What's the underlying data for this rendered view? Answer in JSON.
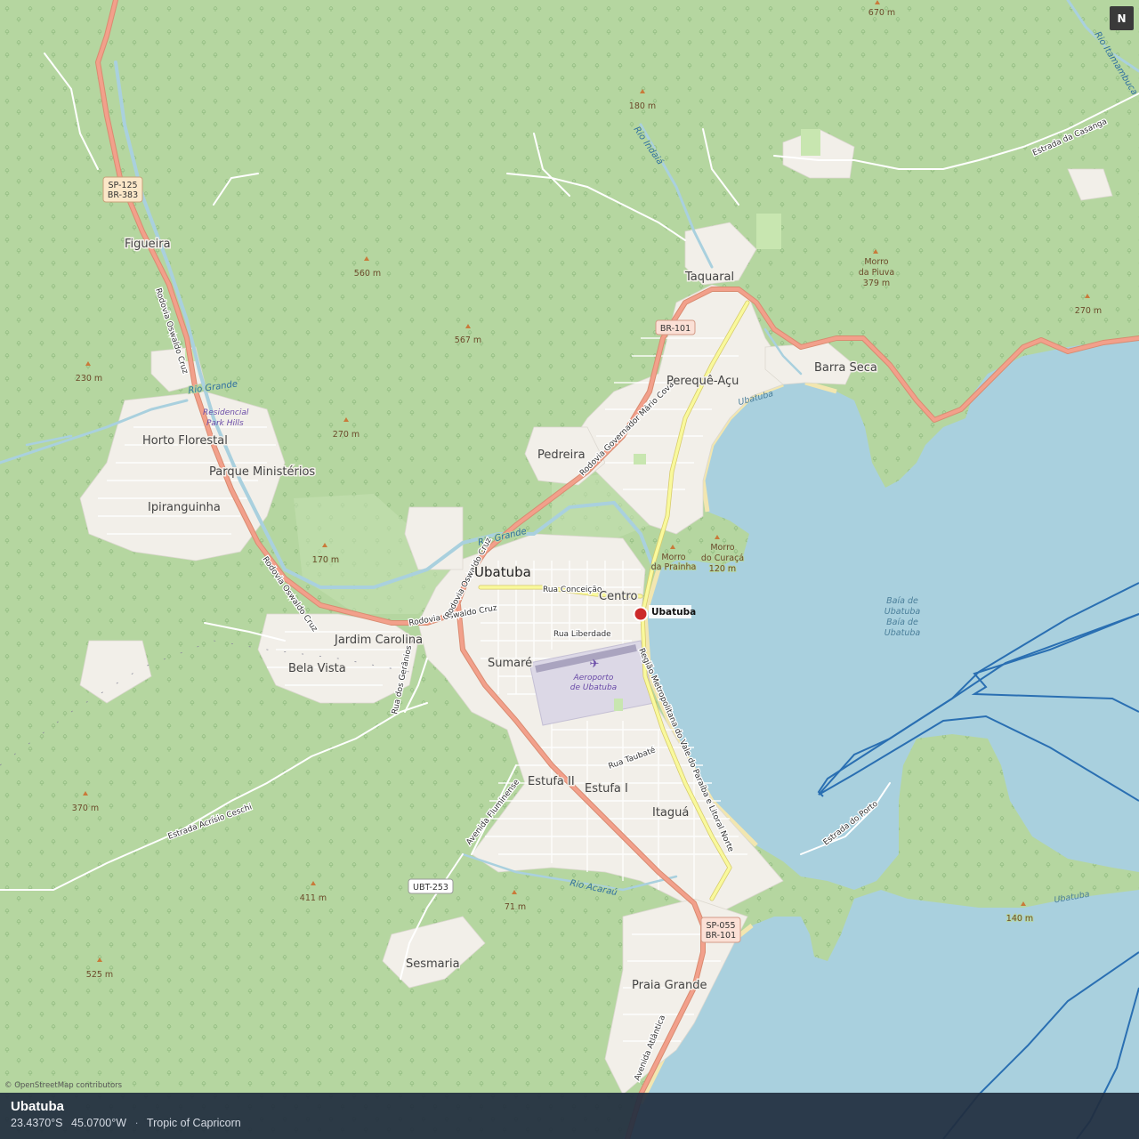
{
  "map": {
    "compass": "N",
    "attribution": "© OpenStreetMap contributors",
    "marker": {
      "label": "Ubatuba",
      "color": "#cc2a2a"
    },
    "colors": {
      "forest": "#b5d6a0",
      "water": "#a9d0de",
      "urban": "#f2efe9",
      "trunk_road": "#f2a08b",
      "secondary_road": "#f9f99c",
      "route": "#2a6fb2"
    },
    "places": {
      "figueira": "Figueira",
      "horto_florestal": "Horto Florestal",
      "parque_ministerios": "Parque Ministérios",
      "ipiranguinha": "Ipiranguinha",
      "residencial": "Residencial",
      "park_hills": "Park Hills",
      "taquaral": "Taquaral",
      "pereque": "Perequê-Açu",
      "barra_seca": "Barra Seca",
      "pedreira": "Pedreira",
      "ubatuba": "Ubatuba",
      "centro": "Centro",
      "jardim_carolina": "Jardim Carolina",
      "bela_vista": "Bela Vista",
      "sumare": "Sumaré",
      "estufa_ii": "Estufa II",
      "estufa_i": "Estufa I",
      "itagua": "Itaguá",
      "sesmaria": "Sesmaria",
      "praia_grande": "Praia Grande"
    },
    "peaks": {
      "p670": "670 m",
      "p180": "180 m",
      "p560": "560 m",
      "p567": "567 m",
      "p230": "230 m",
      "p270a": "270 m",
      "p170": "170 m",
      "piuva_1": "Morro",
      "piuva_2": "da Piuva",
      "piuva_3": "379 m",
      "p270b": "270 m",
      "prainha_1": "Morro",
      "prainha_2": "da Prainha",
      "curaca_1": "Morro",
      "curaca_2": "do Curaçá",
      "curaca_3": "120 m",
      "p370": "370 m",
      "p411": "411 m",
      "p71": "71 m",
      "p525": "525 m",
      "p140": "140 m"
    },
    "rivers": {
      "rio_grande_a": "Rio Grande",
      "rio_grande_b": "Rio Grande",
      "rio_indaia": "Rio Indaiá",
      "rio_acarau": "Rio Acaraú",
      "rio_itamambuca": "Rio Itamambuca"
    },
    "water": {
      "baia_1": "Baía de",
      "baia_2": "Ubatuba",
      "baia_3": "Baía de",
      "baia_4": "Ubatuba",
      "coast_a": "Ubatuba",
      "coast_b": "Ubatuba"
    },
    "streets": {
      "oswaldo_cruz_n": "Rodovia Oswaldo Cruz",
      "oswaldo_cruz_s1": "Rodovia Oswaldo Cruz",
      "oswaldo_cruz_s2": "Rodovia Oswaldo Cruz",
      "oswaldo_cruz_e": "Rodovia Oswaldo Cruz",
      "mario_covas": "Rodovia Governador Mário Covas",
      "rua_conceicao": "Rua Conceição",
      "rua_liberdade": "Rua Liberdade",
      "rua_geranios": "Rua dos Gerânios 2",
      "rua_taubate": "Rua Taubaté",
      "av_fluminense": "Avenida Fluminense",
      "estrada_ceschi": "Estrada Acrísio Ceschi",
      "estrada_porto": "Estrada do Porto",
      "estrada_casanga": "Estrada da Casanga",
      "regiao": "Região Metropolitana do Vale do Paraíba e Litoral Norte",
      "av_atlantica": "Avenida Atlântica"
    },
    "shields": {
      "sp125_1": "SP-125",
      "sp125_2": "BR-383",
      "br101": "BR-101",
      "ubt253": "UBT-253",
      "sp055_1": "SP-055",
      "sp055_2": "BR-101"
    },
    "pois": {
      "aeroporto_1": "Aeroporto",
      "aeroporto_2": "de Ubatuba"
    }
  },
  "info_bar": {
    "title": "Ubatuba",
    "latitude": "23.4370°S",
    "longitude": "45.0700°W",
    "separator": "·",
    "note": "Tropic of Capricorn"
  }
}
